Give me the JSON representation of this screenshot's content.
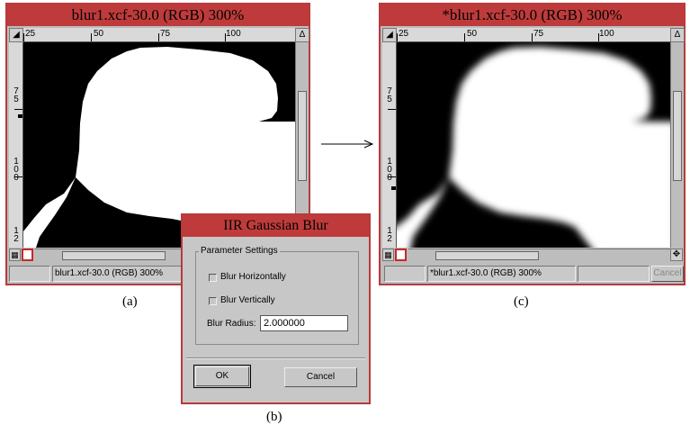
{
  "window_a": {
    "title": "blur1.xcf-30.0 (RGB) 300%",
    "status_text": "blur1.xcf-30.0 (RGB) 300%",
    "ruler_h_labels": [
      "25",
      "50",
      "75",
      "100"
    ],
    "ruler_v_labels": [
      "75",
      "100",
      "12"
    ],
    "caption": "(a)"
  },
  "window_c": {
    "title": "*blur1.xcf-30.0 (RGB) 300%",
    "status_text": "*blur1.xcf-30.0 (RGB) 300%",
    "cancel_label": "Cancel",
    "ruler_h_labels": [
      "25",
      "50",
      "75",
      "100"
    ],
    "ruler_v_labels": [
      "75",
      "100",
      "12"
    ],
    "caption": "(c)"
  },
  "dialog": {
    "title": "IIR Gaussian Blur",
    "group_title": "Parameter Settings",
    "blur_horizontally_label": "Blur Horizontally",
    "blur_horizontally_checked": false,
    "blur_vertically_label": "Blur Vertically",
    "blur_vertically_checked": false,
    "blur_radius_label": "Blur Radius:",
    "blur_radius_value": "2.000000",
    "ok_label": "OK",
    "cancel_label": "Cancel",
    "caption": "(b)"
  },
  "colors": {
    "title_bar": "#bf3b3b",
    "window_bg": "#bdbdbd",
    "canvas_bg": "#000000",
    "shape_fill": "#ffffff"
  }
}
